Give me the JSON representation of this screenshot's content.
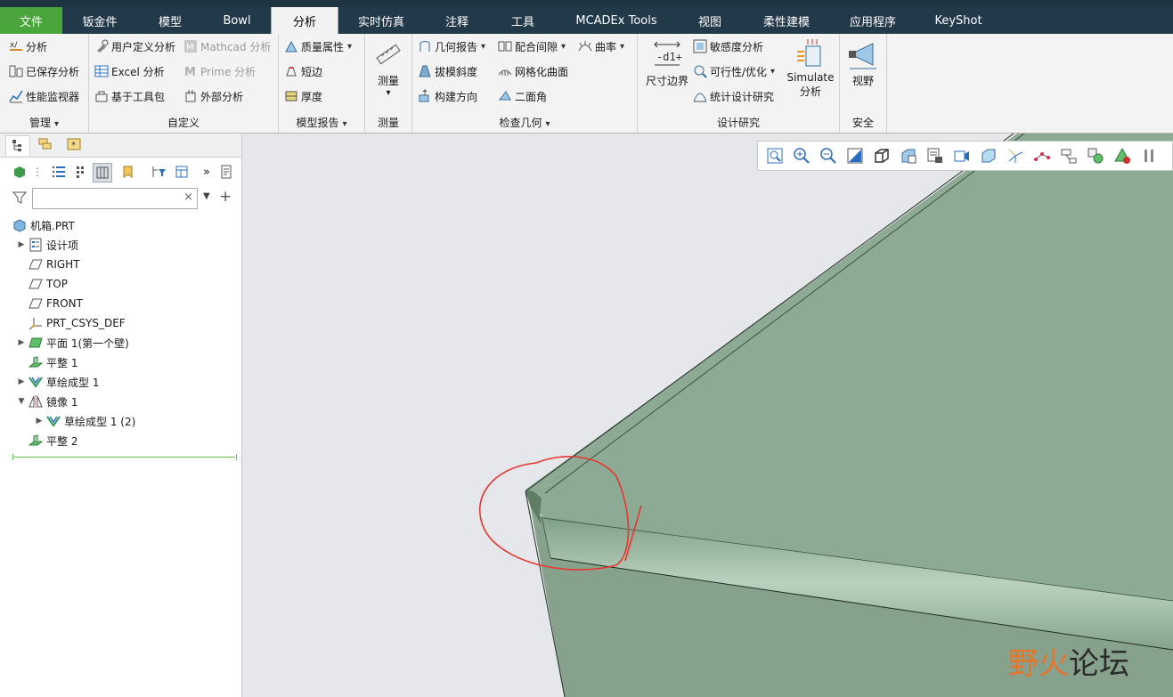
{
  "menu": {
    "tabs": [
      "文件",
      "钣金件",
      "模型",
      "Bowl",
      "分析",
      "实时仿真",
      "注释",
      "工具",
      "MCADEx Tools",
      "视图",
      "柔性建模",
      "应用程序",
      "KeyShot"
    ],
    "active_index": 4,
    "accent_file": "#4aa53c"
  },
  "ribbon": {
    "manage": {
      "label": "管理",
      "items": [
        "分析",
        "已保存分析",
        "性能监视器"
      ]
    },
    "custom": {
      "label": "自定义",
      "items": [
        "用户定义分析",
        "Excel 分析",
        "基于工具包",
        "Mathcad 分析",
        "Prime 分析",
        "外部分析"
      ]
    },
    "model_report": {
      "label": "模型报告",
      "items": [
        "质量属性",
        "短边",
        "厚度"
      ]
    },
    "measure": {
      "label": "测量",
      "button": "测量"
    },
    "inspect": {
      "label": "检查几何",
      "items": [
        "几何报告",
        "拔模斜度",
        "构建方向",
        "配合间隙",
        "网格化曲面",
        "二面角",
        "曲率"
      ]
    },
    "design_study": {
      "label": "设计研究",
      "dim_boundary": "尺寸边界",
      "items": [
        "敏感度分析",
        "可行性/优化",
        "统计设计研究"
      ],
      "simulate_line1": "Simulate",
      "simulate_line2": "分析"
    },
    "safety": {
      "label": "安全",
      "button": "视野"
    }
  },
  "panel": {
    "search_placeholder": "",
    "tree": [
      {
        "label": "机箱.PRT",
        "icon": "part-icon",
        "arrow": ""
      },
      {
        "label": "设计项",
        "icon": "design-items-icon",
        "arrow": "▶"
      },
      {
        "label": "RIGHT",
        "icon": "datum-plane-icon",
        "arrow": ""
      },
      {
        "label": "TOP",
        "icon": "datum-plane-icon",
        "arrow": ""
      },
      {
        "label": "FRONT",
        "icon": "datum-plane-icon",
        "arrow": ""
      },
      {
        "label": "PRT_CSYS_DEF",
        "icon": "csys-icon",
        "arrow": ""
      },
      {
        "label": "平面 1(第一个壁)",
        "icon": "planar-wall-icon",
        "arrow": "▶"
      },
      {
        "label": "平整 1",
        "icon": "flat-wall-icon",
        "arrow": ""
      },
      {
        "label": "草绘成型 1",
        "icon": "sketched-form-icon",
        "arrow": "▶"
      },
      {
        "label": "镜像 1",
        "icon": "mirror-icon",
        "arrow": "▼"
      },
      {
        "label": "草绘成型 1 (2)",
        "icon": "sketched-form-icon",
        "arrow": "▶"
      },
      {
        "label": "平整 2",
        "icon": "flat-wall-icon",
        "arrow": ""
      }
    ]
  },
  "watermark": {
    "part1": "野火",
    "part2": "论坛"
  }
}
